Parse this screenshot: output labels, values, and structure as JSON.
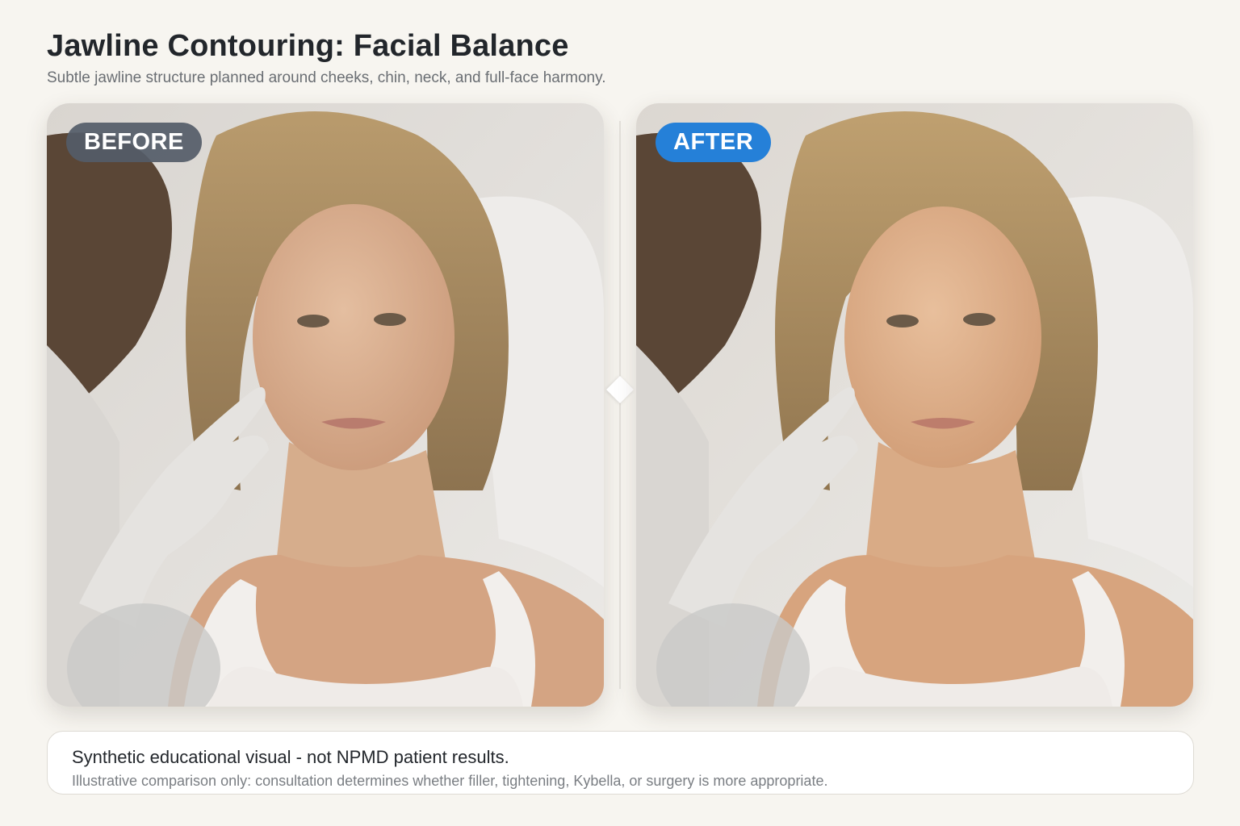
{
  "header": {
    "title": "Jawline Contouring: Facial Balance",
    "subtitle": "Subtle jawline structure planned around cheeks, chin, neck, and full-face harmony."
  },
  "panels": [
    {
      "label": "BEFORE",
      "image": "patient-photo-before-treatment"
    },
    {
      "label": "AFTER",
      "image": "patient-photo-after-treatment"
    }
  ],
  "colors": {
    "before_badge": "#545c68",
    "after_badge": "#2580d8",
    "background": "#f7f5f0"
  },
  "disclaimer": {
    "main": "Synthetic educational visual - not NPMD patient results.",
    "sub": "Illustrative comparison only: consultation determines whether filler, tightening, Kybella, or surgery is more appropriate."
  }
}
